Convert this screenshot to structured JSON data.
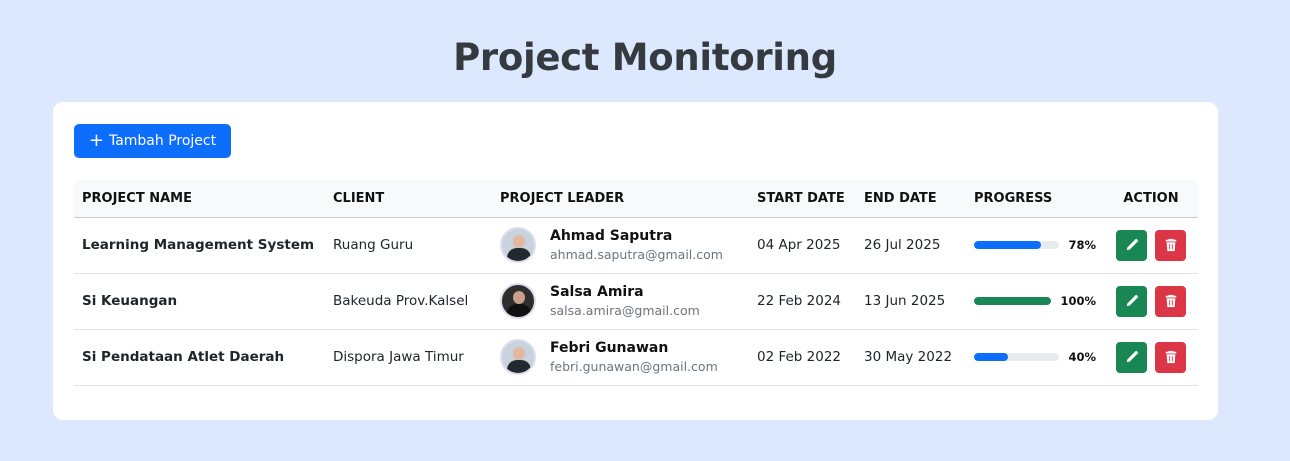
{
  "page": {
    "title": "Project Monitoring"
  },
  "toolbar": {
    "add_label": "Tambah Project"
  },
  "colors": {
    "primary": "#0d6efd",
    "success": "#198754",
    "danger": "#dc3545"
  },
  "table": {
    "headers": [
      "PROJECT NAME",
      "CLIENT",
      "PROJECT LEADER",
      "START DATE",
      "END DATE",
      "PROGRESS",
      "ACTION"
    ],
    "rows": [
      {
        "project_name": "Learning Management System",
        "client": "Ruang Guru",
        "leader_name": "Ahmad Saputra",
        "leader_email": "ahmad.saputra@gmail.com",
        "start_date": "04 Apr 2025",
        "end_date": "26 Jul 2025",
        "progress": 78,
        "progress_label": "78%",
        "progress_color": "#0d6efd"
      },
      {
        "project_name": "Si Keuangan",
        "client": "Bakeuda Prov.Kalsel",
        "leader_name": "Salsa Amira",
        "leader_email": "salsa.amira@gmail.com",
        "start_date": "22 Feb 2024",
        "end_date": "13 Jun 2025",
        "progress": 100,
        "progress_label": "100%",
        "progress_color": "#198754"
      },
      {
        "project_name": "Si Pendataan Atlet Daerah",
        "client": "Dispora Jawa Timur",
        "leader_name": "Febri Gunawan",
        "leader_email": "febri.gunawan@gmail.com",
        "start_date": "02 Feb 2022",
        "end_date": "30 May 2022",
        "progress": 40,
        "progress_label": "40%",
        "progress_color": "#0d6efd"
      }
    ]
  }
}
